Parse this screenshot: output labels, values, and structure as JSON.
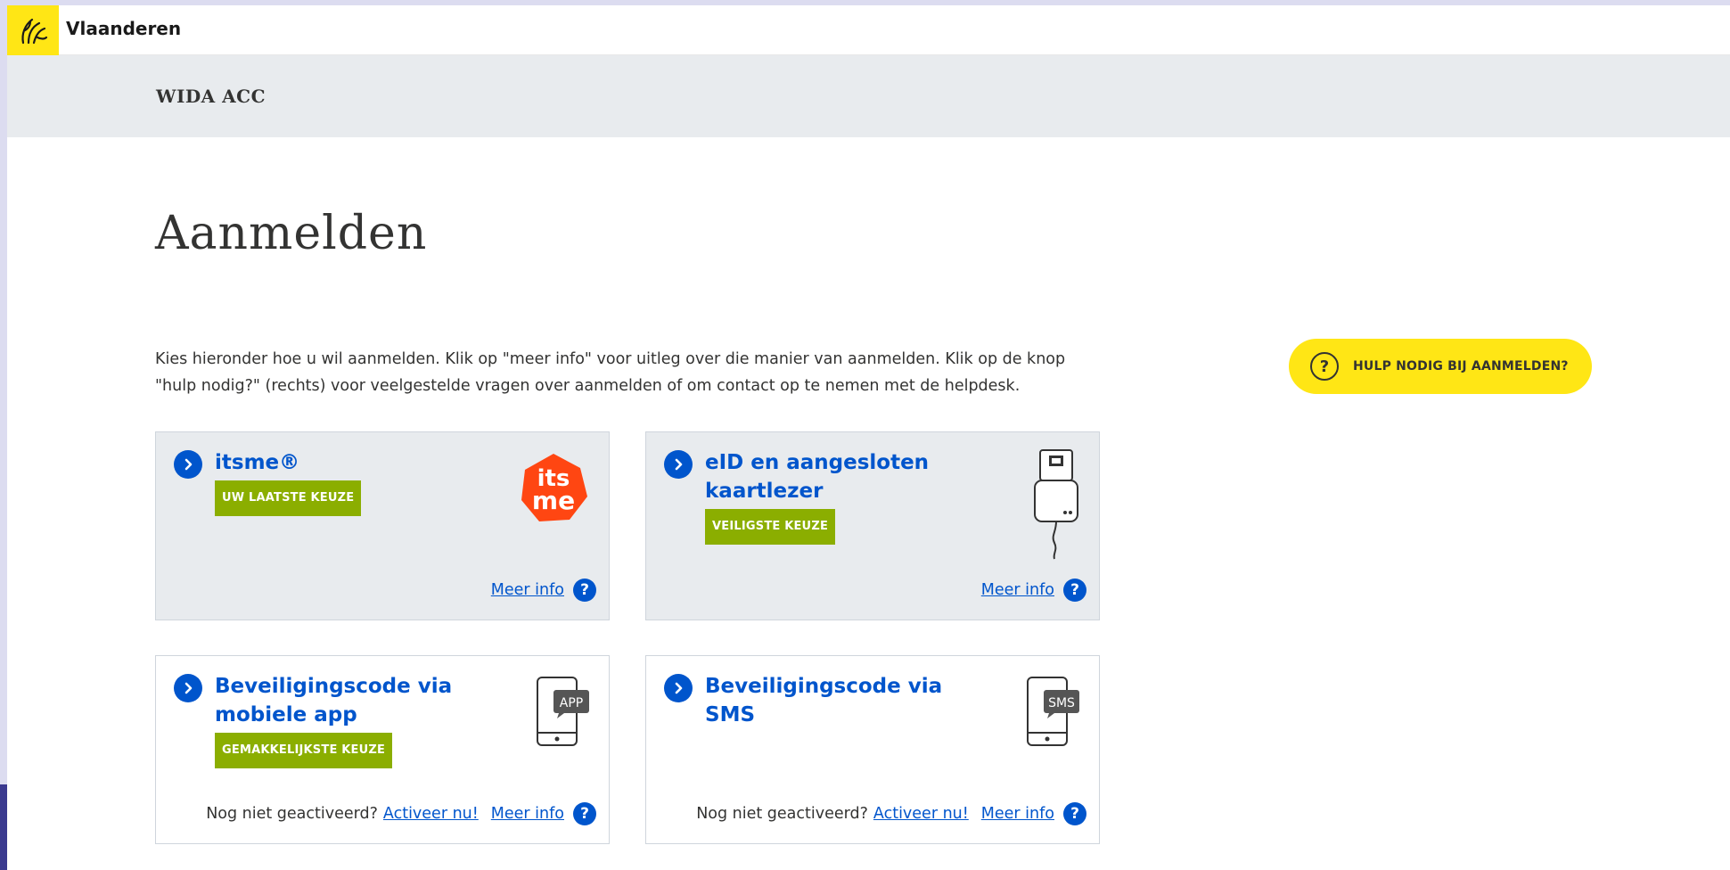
{
  "header": {
    "brand": "Vlaanderen",
    "app_title": "WIDA ACC"
  },
  "page": {
    "title": "Aanmelden",
    "intro_line1": "Kies hieronder hoe u wil aanmelden. Klik op \"meer info\" voor uitleg over die manier van aanmelden. Klik op de knop",
    "intro_line2": "\"hulp nodig?\" (rechts) voor veelgestelde vragen over aanmelden of om contact op te nemen met de helpdesk."
  },
  "help_button": {
    "icon": "?",
    "label": "HULP NODIG BIJ AANMELDEN?"
  },
  "cards": [
    {
      "title": "itsme®",
      "badge": "UW LAATSTE KEUZE",
      "meer_info": "Meer info",
      "icon": "itsme-logo-icon",
      "logo_line1": "its",
      "logo_line2": "me"
    },
    {
      "title": "eID en aangesloten kaartlezer",
      "badge": "VEILIGSTE KEUZE",
      "meer_info": "Meer info",
      "icon": "card-reader-icon"
    },
    {
      "title": "Beveiligingscode via mobiele app",
      "badge": "GEMAKKELIJKSTE KEUZE",
      "meer_info": "Meer info",
      "not_activated": "Nog niet geactiveerd?",
      "activate": "Activeer nu!",
      "icon": "phone-app-icon",
      "icon_label": "APP"
    },
    {
      "title": "Beveiligingscode via SMS",
      "meer_info": "Meer info",
      "not_activated": "Nog niet geactiveerd?",
      "activate": "Activeer nu!",
      "icon": "phone-sms-icon",
      "icon_label": "SMS"
    }
  ],
  "colors": {
    "accent_yellow": "#ffe615",
    "link_blue": "#0055cc",
    "badge_green": "#8bae00",
    "card_gray": "#e8ebee",
    "itsme_orange": "#ff4612"
  }
}
